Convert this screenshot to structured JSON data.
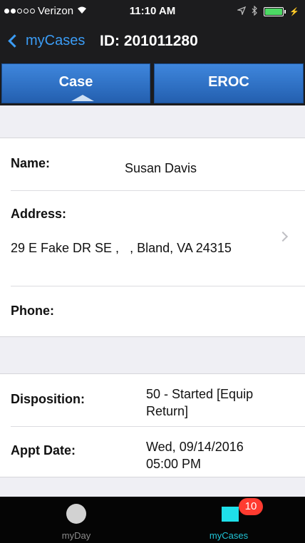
{
  "status_bar": {
    "carrier": "Verizon",
    "time": "11:10 AM"
  },
  "nav": {
    "back_label": "myCases",
    "title": "ID: 201011280"
  },
  "tabs": [
    {
      "label": "Case",
      "selected": true
    },
    {
      "label": "EROC",
      "selected": false
    }
  ],
  "case_info": {
    "name_label": "Name:",
    "name_value": "Susan Davis",
    "address_label": "Address:",
    "address_value": "29 E Fake DR SE ,   , Bland, VA 24315",
    "phone_label": "Phone:",
    "phone_value": ""
  },
  "status_info": {
    "disposition_label": "Disposition:",
    "disposition_value_line1": "50 - Started [Equip",
    "disposition_value_line2": "Return]",
    "appt_label": "Appt Date:",
    "appt_value_line1": "Wed, 09/14/2016",
    "appt_value_line2": "05:00 PM"
  },
  "tabbar": {
    "items": [
      {
        "label": "myDay",
        "icon": "circle-icon"
      },
      {
        "label": "myCases",
        "icon": "square-icon",
        "badge": "10"
      }
    ]
  },
  "colors": {
    "accent_blue": "#3b9cf5",
    "tab_blue": "#2e6fc2",
    "active_tab_cyan": "#20c4d6",
    "badge_red": "#ff3b30"
  }
}
